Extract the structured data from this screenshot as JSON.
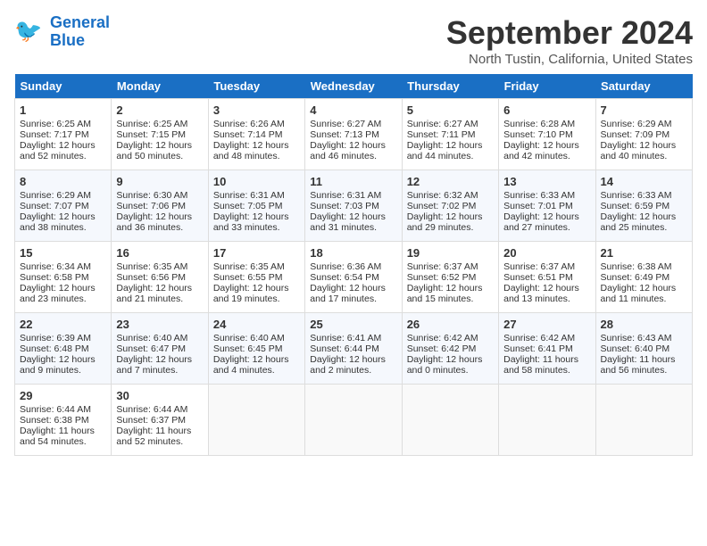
{
  "logo": {
    "line1": "General",
    "line2": "Blue"
  },
  "title": "September 2024",
  "location": "North Tustin, California, United States",
  "days_of_week": [
    "Sunday",
    "Monday",
    "Tuesday",
    "Wednesday",
    "Thursday",
    "Friday",
    "Saturday"
  ],
  "weeks": [
    [
      {
        "day": "1",
        "sunrise": "6:25 AM",
        "sunset": "7:17 PM",
        "daylight": "12 hours and 52 minutes."
      },
      {
        "day": "2",
        "sunrise": "6:25 AM",
        "sunset": "7:15 PM",
        "daylight": "12 hours and 50 minutes."
      },
      {
        "day": "3",
        "sunrise": "6:26 AM",
        "sunset": "7:14 PM",
        "daylight": "12 hours and 48 minutes."
      },
      {
        "day": "4",
        "sunrise": "6:27 AM",
        "sunset": "7:13 PM",
        "daylight": "12 hours and 46 minutes."
      },
      {
        "day": "5",
        "sunrise": "6:27 AM",
        "sunset": "7:11 PM",
        "daylight": "12 hours and 44 minutes."
      },
      {
        "day": "6",
        "sunrise": "6:28 AM",
        "sunset": "7:10 PM",
        "daylight": "12 hours and 42 minutes."
      },
      {
        "day": "7",
        "sunrise": "6:29 AM",
        "sunset": "7:09 PM",
        "daylight": "12 hours and 40 minutes."
      }
    ],
    [
      {
        "day": "8",
        "sunrise": "6:29 AM",
        "sunset": "7:07 PM",
        "daylight": "12 hours and 38 minutes."
      },
      {
        "day": "9",
        "sunrise": "6:30 AM",
        "sunset": "7:06 PM",
        "daylight": "12 hours and 36 minutes."
      },
      {
        "day": "10",
        "sunrise": "6:31 AM",
        "sunset": "7:05 PM",
        "daylight": "12 hours and 33 minutes."
      },
      {
        "day": "11",
        "sunrise": "6:31 AM",
        "sunset": "7:03 PM",
        "daylight": "12 hours and 31 minutes."
      },
      {
        "day": "12",
        "sunrise": "6:32 AM",
        "sunset": "7:02 PM",
        "daylight": "12 hours and 29 minutes."
      },
      {
        "day": "13",
        "sunrise": "6:33 AM",
        "sunset": "7:01 PM",
        "daylight": "12 hours and 27 minutes."
      },
      {
        "day": "14",
        "sunrise": "6:33 AM",
        "sunset": "6:59 PM",
        "daylight": "12 hours and 25 minutes."
      }
    ],
    [
      {
        "day": "15",
        "sunrise": "6:34 AM",
        "sunset": "6:58 PM",
        "daylight": "12 hours and 23 minutes."
      },
      {
        "day": "16",
        "sunrise": "6:35 AM",
        "sunset": "6:56 PM",
        "daylight": "12 hours and 21 minutes."
      },
      {
        "day": "17",
        "sunrise": "6:35 AM",
        "sunset": "6:55 PM",
        "daylight": "12 hours and 19 minutes."
      },
      {
        "day": "18",
        "sunrise": "6:36 AM",
        "sunset": "6:54 PM",
        "daylight": "12 hours and 17 minutes."
      },
      {
        "day": "19",
        "sunrise": "6:37 AM",
        "sunset": "6:52 PM",
        "daylight": "12 hours and 15 minutes."
      },
      {
        "day": "20",
        "sunrise": "6:37 AM",
        "sunset": "6:51 PM",
        "daylight": "12 hours and 13 minutes."
      },
      {
        "day": "21",
        "sunrise": "6:38 AM",
        "sunset": "6:49 PM",
        "daylight": "12 hours and 11 minutes."
      }
    ],
    [
      {
        "day": "22",
        "sunrise": "6:39 AM",
        "sunset": "6:48 PM",
        "daylight": "12 hours and 9 minutes."
      },
      {
        "day": "23",
        "sunrise": "6:40 AM",
        "sunset": "6:47 PM",
        "daylight": "12 hours and 7 minutes."
      },
      {
        "day": "24",
        "sunrise": "6:40 AM",
        "sunset": "6:45 PM",
        "daylight": "12 hours and 4 minutes."
      },
      {
        "day": "25",
        "sunrise": "6:41 AM",
        "sunset": "6:44 PM",
        "daylight": "12 hours and 2 minutes."
      },
      {
        "day": "26",
        "sunrise": "6:42 AM",
        "sunset": "6:42 PM",
        "daylight": "12 hours and 0 minutes."
      },
      {
        "day": "27",
        "sunrise": "6:42 AM",
        "sunset": "6:41 PM",
        "daylight": "11 hours and 58 minutes."
      },
      {
        "day": "28",
        "sunrise": "6:43 AM",
        "sunset": "6:40 PM",
        "daylight": "11 hours and 56 minutes."
      }
    ],
    [
      {
        "day": "29",
        "sunrise": "6:44 AM",
        "sunset": "6:38 PM",
        "daylight": "11 hours and 54 minutes."
      },
      {
        "day": "30",
        "sunrise": "6:44 AM",
        "sunset": "6:37 PM",
        "daylight": "11 hours and 52 minutes."
      },
      null,
      null,
      null,
      null,
      null
    ]
  ]
}
